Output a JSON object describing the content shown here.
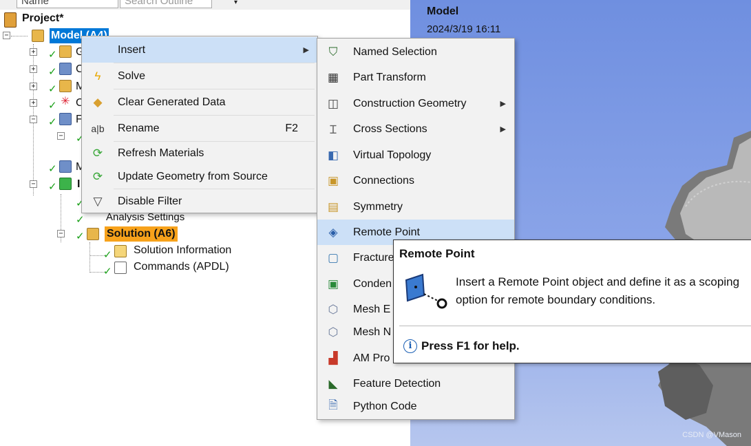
{
  "search_bar": {
    "name_label": "Name",
    "search_placeholder": "Search Outline",
    "caret": "▾"
  },
  "tree": {
    "root_label": "Project*",
    "model_label": "Model (A4)",
    "analysis_settings_label": "Analysis Settings",
    "solution_label": "Solution (A6)",
    "solution_information_label": "Solution Information",
    "commands_label": "Commands (APDL)",
    "partial_labels": [
      "G",
      "C",
      "M",
      "C",
      "F",
      "M",
      "I"
    ]
  },
  "viewport": {
    "title": "Model",
    "date": "2024/3/19 16:11",
    "watermark": "CSDN @VMason"
  },
  "context_menu": {
    "items": [
      {
        "label": "Insert",
        "icon": "none",
        "has_submenu": true
      },
      {
        "label": "Solve",
        "icon": "lightning-icon"
      },
      {
        "label": "Clear Generated Data",
        "icon": "eraser-icon"
      },
      {
        "label": "Rename",
        "icon": "rename-icon",
        "shortcut": "F2"
      },
      {
        "label": "Refresh Materials",
        "icon": "refresh-icon"
      },
      {
        "label": "Update Geometry from Source",
        "icon": "refresh-icon"
      },
      {
        "label": "Disable Filter",
        "icon": "filter-icon"
      }
    ]
  },
  "insert_submenu": {
    "items": [
      {
        "label": "Named Selection",
        "icon": "named-selection-icon"
      },
      {
        "label": "Part Transform",
        "icon": "part-transform-icon"
      },
      {
        "label": "Construction Geometry",
        "icon": "construction-geometry-icon",
        "has_submenu": true
      },
      {
        "label": "Cross Sections",
        "icon": "cross-sections-icon",
        "has_submenu": true
      },
      {
        "label": "Virtual Topology",
        "icon": "virtual-topology-icon"
      },
      {
        "label": "Connections",
        "icon": "connections-icon"
      },
      {
        "label": "Symmetry",
        "icon": "symmetry-icon"
      },
      {
        "label": "Remote Point",
        "icon": "remote-point-icon"
      },
      {
        "label": "Fracture",
        "icon": "fracture-icon"
      },
      {
        "label": "Conden",
        "icon": "condensed-icon"
      },
      {
        "label": "Mesh E",
        "icon": "mesh-edit-icon"
      },
      {
        "label": "Mesh N",
        "icon": "mesh-numbering-icon"
      },
      {
        "label": "AM Pro",
        "icon": "am-process-icon"
      },
      {
        "label": "Feature Detection",
        "icon": "feature-detection-icon"
      },
      {
        "label": "Python Code",
        "icon": "python-code-icon"
      }
    ]
  },
  "tooltip": {
    "title": "Remote Point",
    "description": "Insert a Remote Point object and define it as a scoping option for remote boundary conditions.",
    "help": "Press F1 for help.",
    "help_icon_glyph": "i"
  },
  "colors": {
    "selection_blue": "#0078d7",
    "solution_orange": "#f7a21b",
    "menu_hover": "#cce0f7",
    "check_green": "#1aa018"
  }
}
